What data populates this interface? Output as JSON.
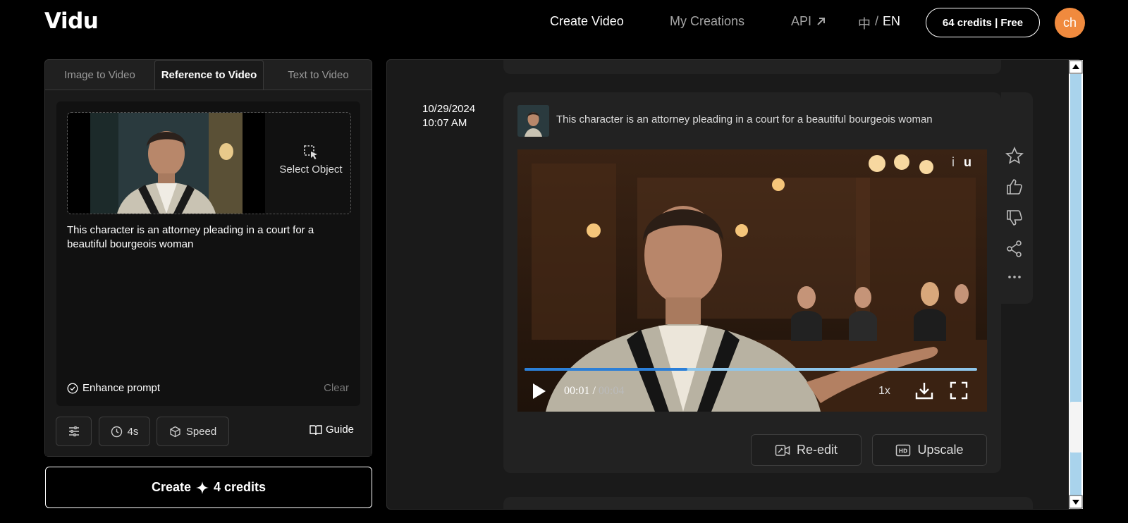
{
  "app": {
    "logo": "Vidu"
  },
  "nav": {
    "create_video": "Create Video",
    "my_creations": "My Creations",
    "api": "API",
    "lang_zh": "中",
    "lang_sep": "/",
    "lang_en": "EN",
    "credits": "64 credits | Free",
    "avatar": "ch"
  },
  "tabs": [
    "Image to Video",
    "Reference to Video",
    "Text to Video"
  ],
  "active_tab": "Reference to Video",
  "prompt_panel": {
    "select_object": "Select Object",
    "prompt": "This character is an attorney pleading in a court for a beautiful bourgeois woman",
    "enhance": "Enhance prompt",
    "clear": "Clear",
    "duration": "4s",
    "speed": "Speed",
    "guide": "Guide"
  },
  "create_button": {
    "label": "Create",
    "credits": "4 credits"
  },
  "generation": {
    "date": "10/29/2024",
    "time": "10:07 AM",
    "prompt": "This character is an attorney pleading in a court for a beautiful bourgeois woman",
    "player": {
      "current": "00:01",
      "sep": "/",
      "duration": "00:04",
      "speed": "1x",
      "progress": 0.36,
      "watermark_i": "i",
      "watermark_u": "u"
    },
    "reedit": "Re-edit",
    "upscale": "Upscale"
  },
  "colors": {
    "avatar": "#f08a3e",
    "progress": "#2b7fd8",
    "scroll_track": "#a9d3ec"
  }
}
